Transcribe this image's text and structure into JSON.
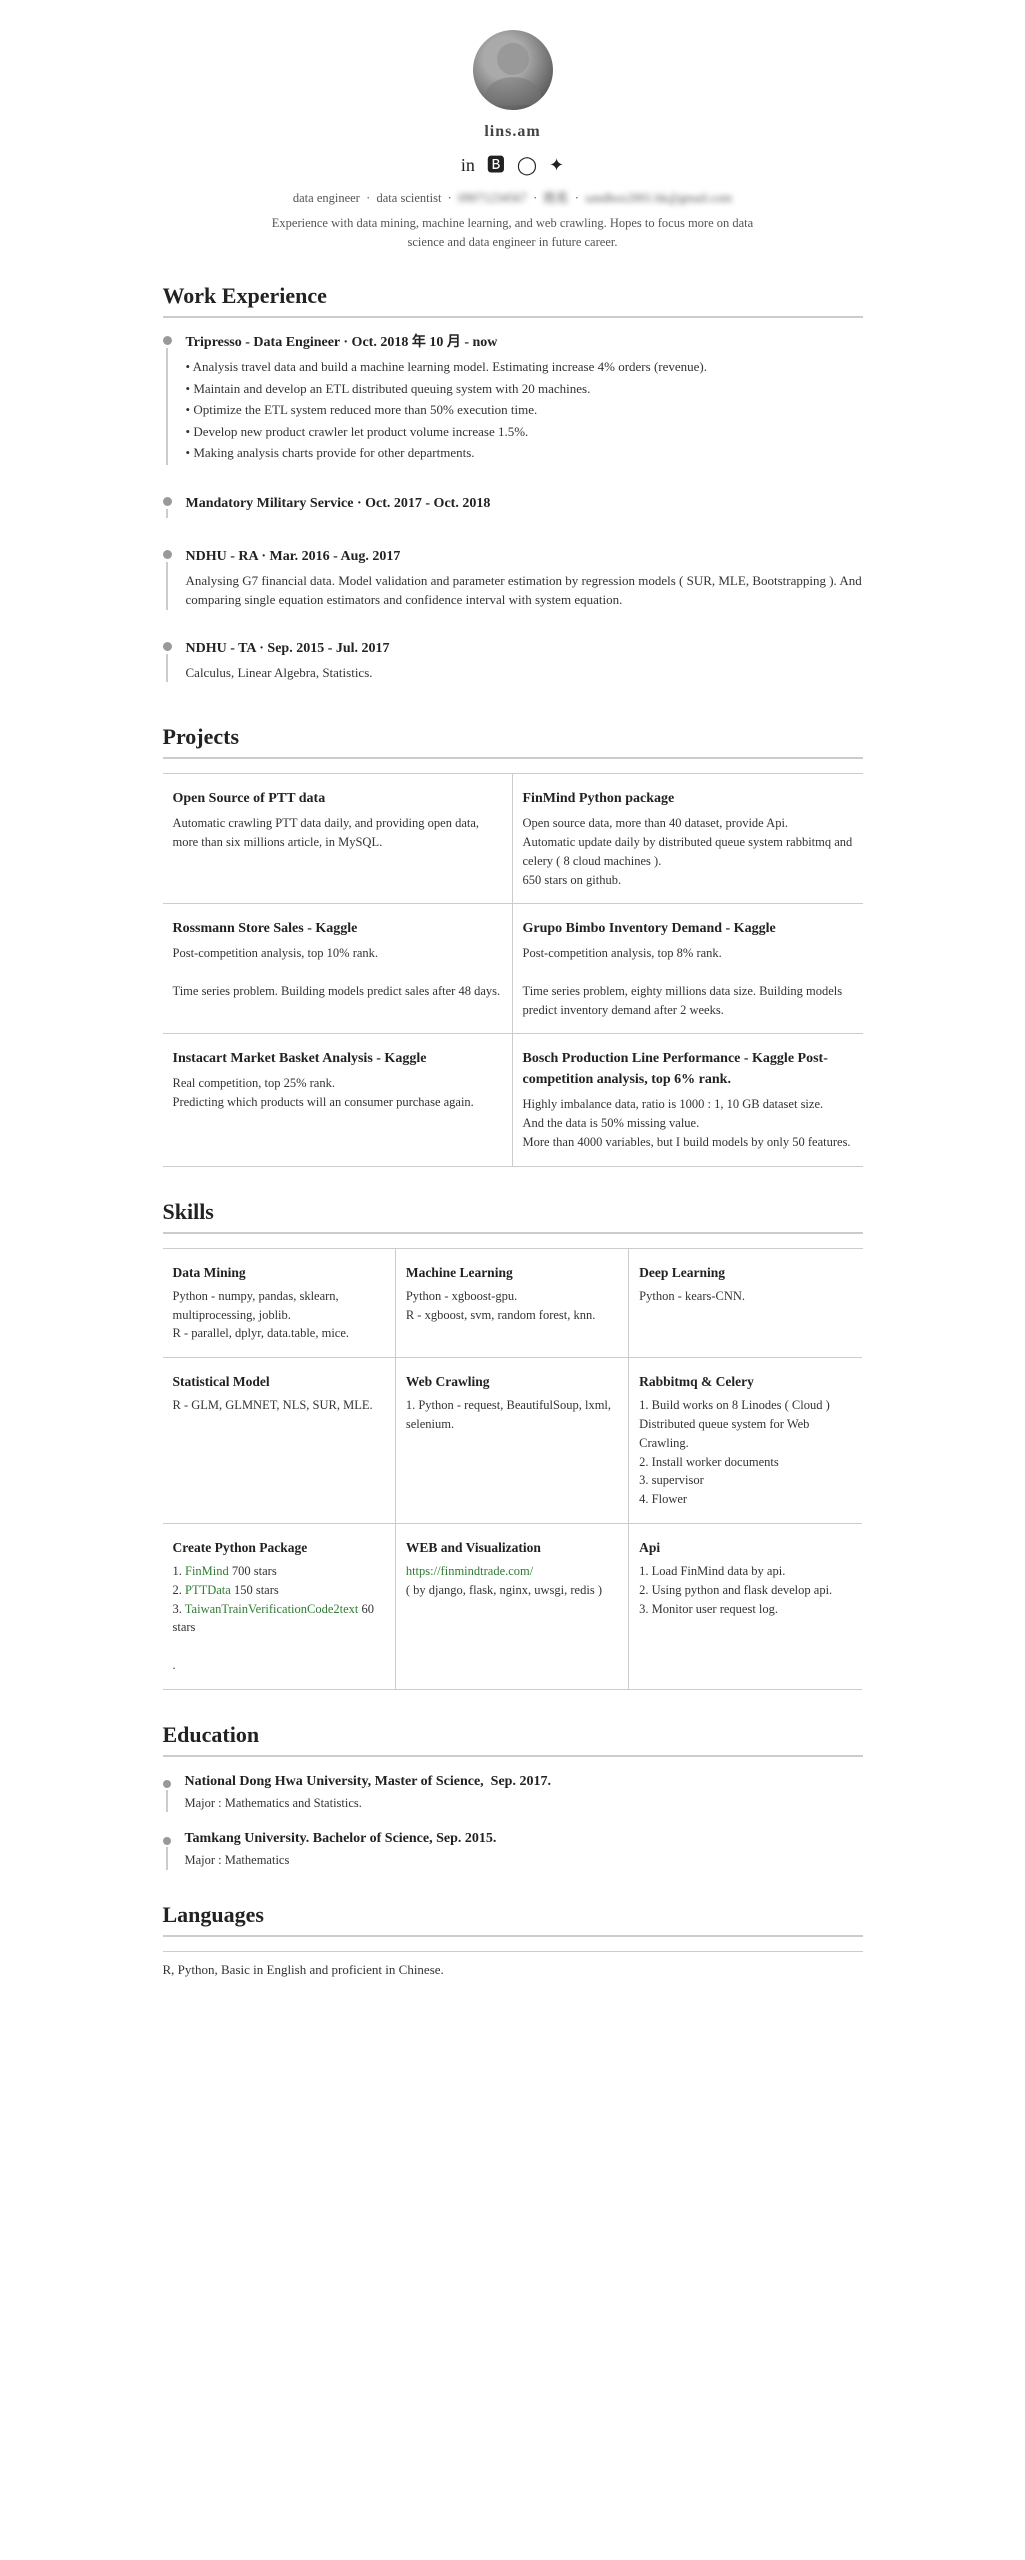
{
  "profile": {
    "name": "lins.am",
    "tagline": "data engineer · data scientist · [phone blurred] · [name blurred] · sandbox2001.hk@gmail.com",
    "bio": "Experience with data mining, machine learning, and web crawling. Hopes to focus more on data science and data engineer in future career.",
    "social": [
      "in",
      "f",
      "⊙",
      "✦"
    ]
  },
  "sections": {
    "work_experience": "Work Experience",
    "projects": "Projects",
    "skills": "Skills",
    "education": "Education",
    "languages": "Languages"
  },
  "work": [
    {
      "title": "Tripresso - Data Engineer · Oct. 2018 年 10 月 - now",
      "bullets": [
        "Analysis travel data and build a machine learning model. Estimating increase 4% orders (revenue).",
        "Maintain and develop an ETL distributed queuing system with 20 machines.",
        "Optimize the ETL system reduced more than 50% execution time.",
        "Develop new product crawler let product volume increase 1.5%.",
        "Making analysis charts provide for other departments."
      ]
    },
    {
      "title": "Mandatory Military Service · Oct. 2017 - Oct. 2018",
      "bullets": []
    },
    {
      "title": "NDHU - RA · Mar. 2016 - Aug. 2017",
      "bullets": [
        "Analysing G7 financial data. Model validation and parameter estimation by regression models ( SUR, MLE, Bootstrapping ). And comparing single equation estimators and confidence interval with system equation."
      ]
    },
    {
      "title": "NDHU - TA · Sep. 2015 - Jul. 2017",
      "bullets": [
        "Calculus, Linear Algebra, Statistics."
      ]
    }
  ],
  "projects": [
    {
      "name": "Open Source of PTT data",
      "desc": "Automatic crawling PTT data daily, and providing open data, more than six millions article, in MySQL."
    },
    {
      "name": "FinMind Python package",
      "desc": "Open source data, more than 40 dataset, provide Api.\nAutomatic update daily by distributed queue system rabbitmq and celery ( 8 cloud machines ).\n650 stars on github."
    },
    {
      "name": "Rossmann Store Sales - Kaggle",
      "desc": "Post-competition analysis, top 10% rank.\n\nTime series problem. Building models predict sales after 48 days."
    },
    {
      "name": "Grupo Bimbo Inventory Demand - Kaggle",
      "desc": "Post-competition analysis, top 8% rank.\n\nTime series problem, eighty millions data size. Building models predict inventory demand after 2 weeks."
    },
    {
      "name": "Instacart Market Basket Analysis - Kaggle",
      "desc": "Real competition, top 25% rank.\nPredicting which products will an consumer purchase again."
    },
    {
      "name": "Bosch Production Line Performance - Kaggle Post-competition analysis, top 6% rank.",
      "desc": "Highly imbalance data, ratio is 1000 : 1, 10 GB dataset size.\nAnd the data is 50% missing value.\nMore than 4000 variables, but I build models by only 50 features."
    }
  ],
  "skills": [
    {
      "name": "Data Mining",
      "desc": "Python - numpy, pandas, sklearn, multiprocessing, joblib.\nR - parallel, dplyr, data.table, mice."
    },
    {
      "name": "Machine Learning",
      "desc": "Python - xgboost-gpu.\nR - xgboost, svm, random forest, knn."
    },
    {
      "name": "Deep Learning",
      "desc": "Python - kears-CNN."
    },
    {
      "name": "Statistical Model",
      "desc": "R - GLM, GLMNET, NLS, SUR, MLE."
    },
    {
      "name": "Web Crawling",
      "desc": "1. Python - request, BeautifulSoup, lxml, selenium."
    },
    {
      "name": "Rabbitmq & Celery",
      "desc": "1. Build works on 8 Linodes ( Cloud ) Distributed queue system for Web Crawling.\n2. Install worker documents\n3. supervisor\n4. Flower"
    },
    {
      "name": "Create Python Package",
      "desc_items": [
        "1. FinMind 700 stars",
        "2. PTTData 150 stars",
        "3. TaiwanTrainVerificationCode2text 60 stars"
      ]
    },
    {
      "name": "WEB and Visualization",
      "desc": "https://finmindtrade.com/\n( by django, flask, nginx, uwsgi, redis )",
      "link": "https://finmindtrade.com/"
    },
    {
      "name": "Api",
      "desc": "1. Load FinMind data by api.\n2. Using python and flask develop api.\n3. Monitor user request log."
    }
  ],
  "education": [
    {
      "title": "National Dong Hwa University, Master of Science,  Sep. 2017.",
      "desc": "Major : Mathematics and Statistics."
    },
    {
      "title": "Tamkang University. Bachelor of Science, Sep. 2015.",
      "desc": "Major : Mathematics"
    }
  ],
  "languages": {
    "desc": "R, Python, Basic in English and proficient in Chinese."
  }
}
